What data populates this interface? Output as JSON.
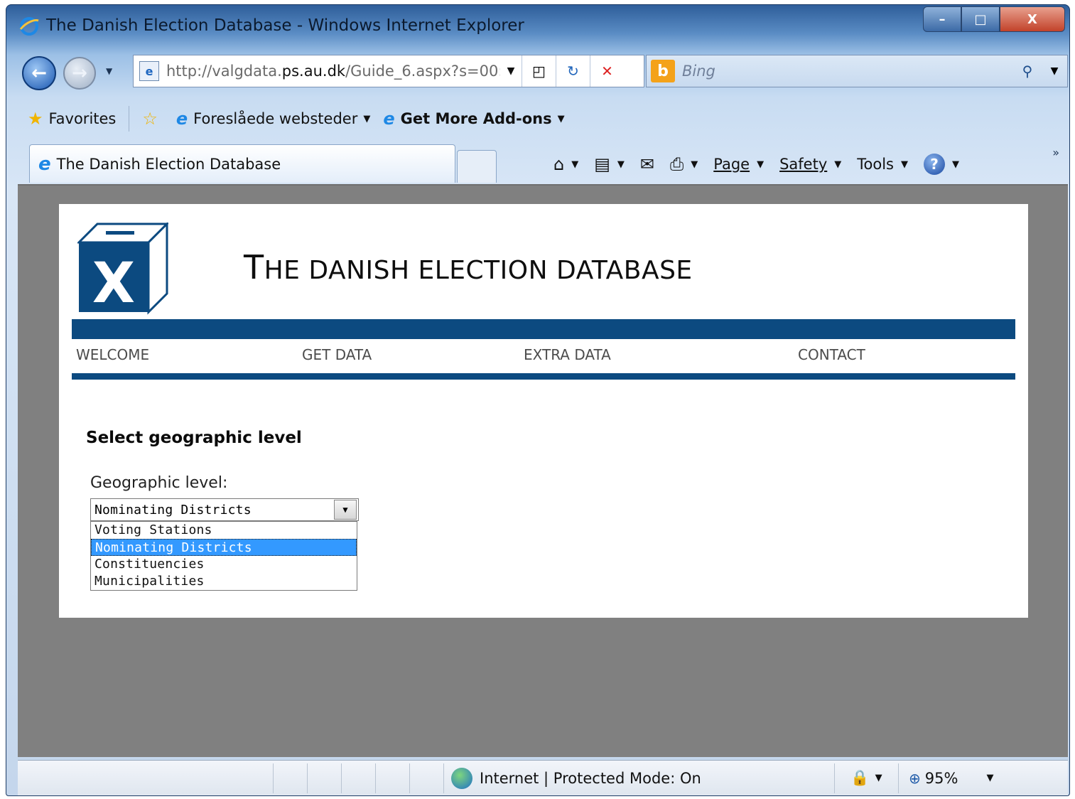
{
  "window": {
    "title": "The Danish Election Database - Windows Internet Explorer",
    "controls": {
      "minimize": "–",
      "maximize": "□",
      "close": "X"
    }
  },
  "navigation": {
    "back_icon": "back-arrow-icon",
    "forward_icon": "forward-arrow-icon",
    "url_prefix": "http://valgdata.",
    "url_domain": "ps.au.dk",
    "url_suffix": "/Guide_6.aspx?s=00:"
  },
  "search": {
    "placeholder": "Bing",
    "logo_letter": "b"
  },
  "favorites_bar": {
    "favorites_label": "Favorites",
    "suggested_sites": "Foreslåede websteder",
    "addons": "Get More Add-ons"
  },
  "tab": {
    "title": "The Danish Election Database"
  },
  "command_bar": {
    "page": "Page",
    "safety": "Safety",
    "tools": "Tools",
    "help": "?"
  },
  "site": {
    "logo_letter": "X",
    "title_first": "T",
    "title_rest": "HE DANISH ELECTION DATABASE",
    "nav": [
      "WELCOME",
      "GET DATA",
      "EXTRA DATA",
      "CONTACT"
    ],
    "section_heading": "Select geographic level",
    "field_label": "Geographic level:",
    "selected_value": "Nominating Districts",
    "options": [
      "Voting Stations",
      "Nominating Districts",
      "Constituencies",
      "Municipalities"
    ],
    "brand_color": "#0c4a80"
  },
  "status_bar": {
    "zone": "Internet | Protected Mode: On",
    "zoom": "95%"
  }
}
